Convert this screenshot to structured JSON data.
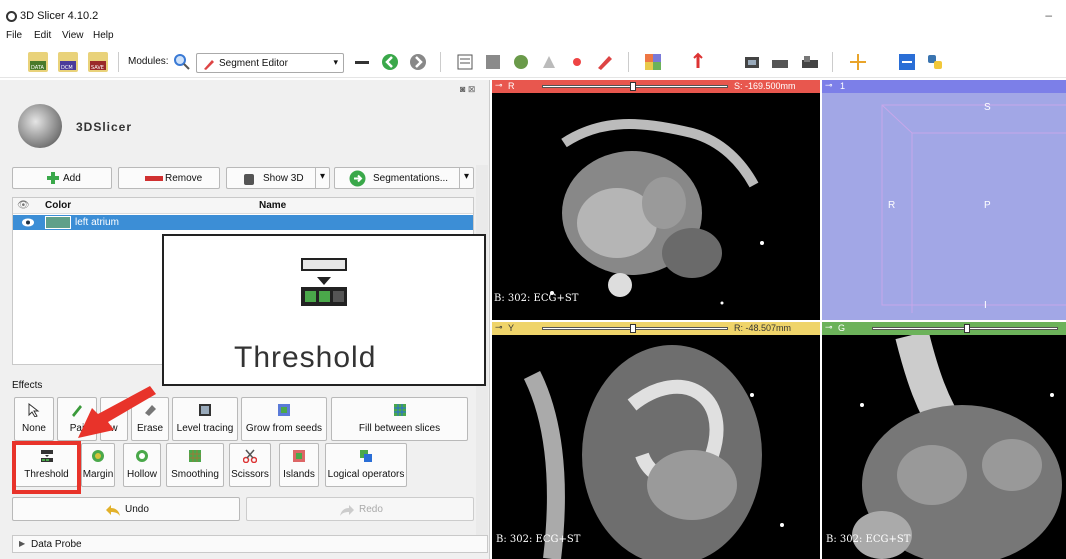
{
  "window": {
    "title": "3D Slicer 4.10.2"
  },
  "menu": [
    "File",
    "Edit",
    "View",
    "Help"
  ],
  "toolbar": {
    "buttons": [
      "DATA",
      "DCM",
      "SAVE"
    ],
    "modules_label": "Modules:",
    "module_selected": "Segment Editor"
  },
  "logo": {
    "text": "3DSlicer"
  },
  "segments": {
    "add_label": "Add",
    "remove_label": "Remove",
    "show3d_label": "Show 3D",
    "segmentations_label": "Segmentations...",
    "col_color": "Color",
    "col_name": "Name",
    "rows": [
      {
        "name": "left atrium",
        "color": "#5fa08a"
      }
    ]
  },
  "zoom": {
    "label": "Threshold"
  },
  "effects": {
    "label": "Effects",
    "row1": [
      "None",
      "Paint",
      "Draw",
      "Erase",
      "Level tracing",
      "Grow from seeds",
      "Fill between slices"
    ],
    "row1_visible": [
      "None",
      "Pai",
      "w",
      "Erase",
      "Level tracing",
      "Grow from seeds",
      "Fill between slices"
    ],
    "row2": [
      "Threshold",
      "Margin",
      "Hollow",
      "Smoothing",
      "Scissors",
      "Islands",
      "Logical operators"
    ]
  },
  "undo_label": "Undo",
  "redo_label": "Redo",
  "data_probe_label": "Data Probe",
  "views": {
    "red": {
      "letter": "R",
      "offset": "S: -169.500mm",
      "label": "B: 302: ECG+ST",
      "color": "#e8574e"
    },
    "yellow": {
      "letter": "Y",
      "offset": "R: -48.507mm",
      "label": "B: 302: ECG+ST",
      "color": "#efd46a"
    },
    "green": {
      "letter": "G",
      "label": "B: 302: ECG+ST",
      "color": "#6cb25a"
    },
    "threed": {
      "letter": "1",
      "color": "#7c7fe8",
      "s": "S",
      "r": "R",
      "p": "P",
      "i": "I"
    }
  }
}
